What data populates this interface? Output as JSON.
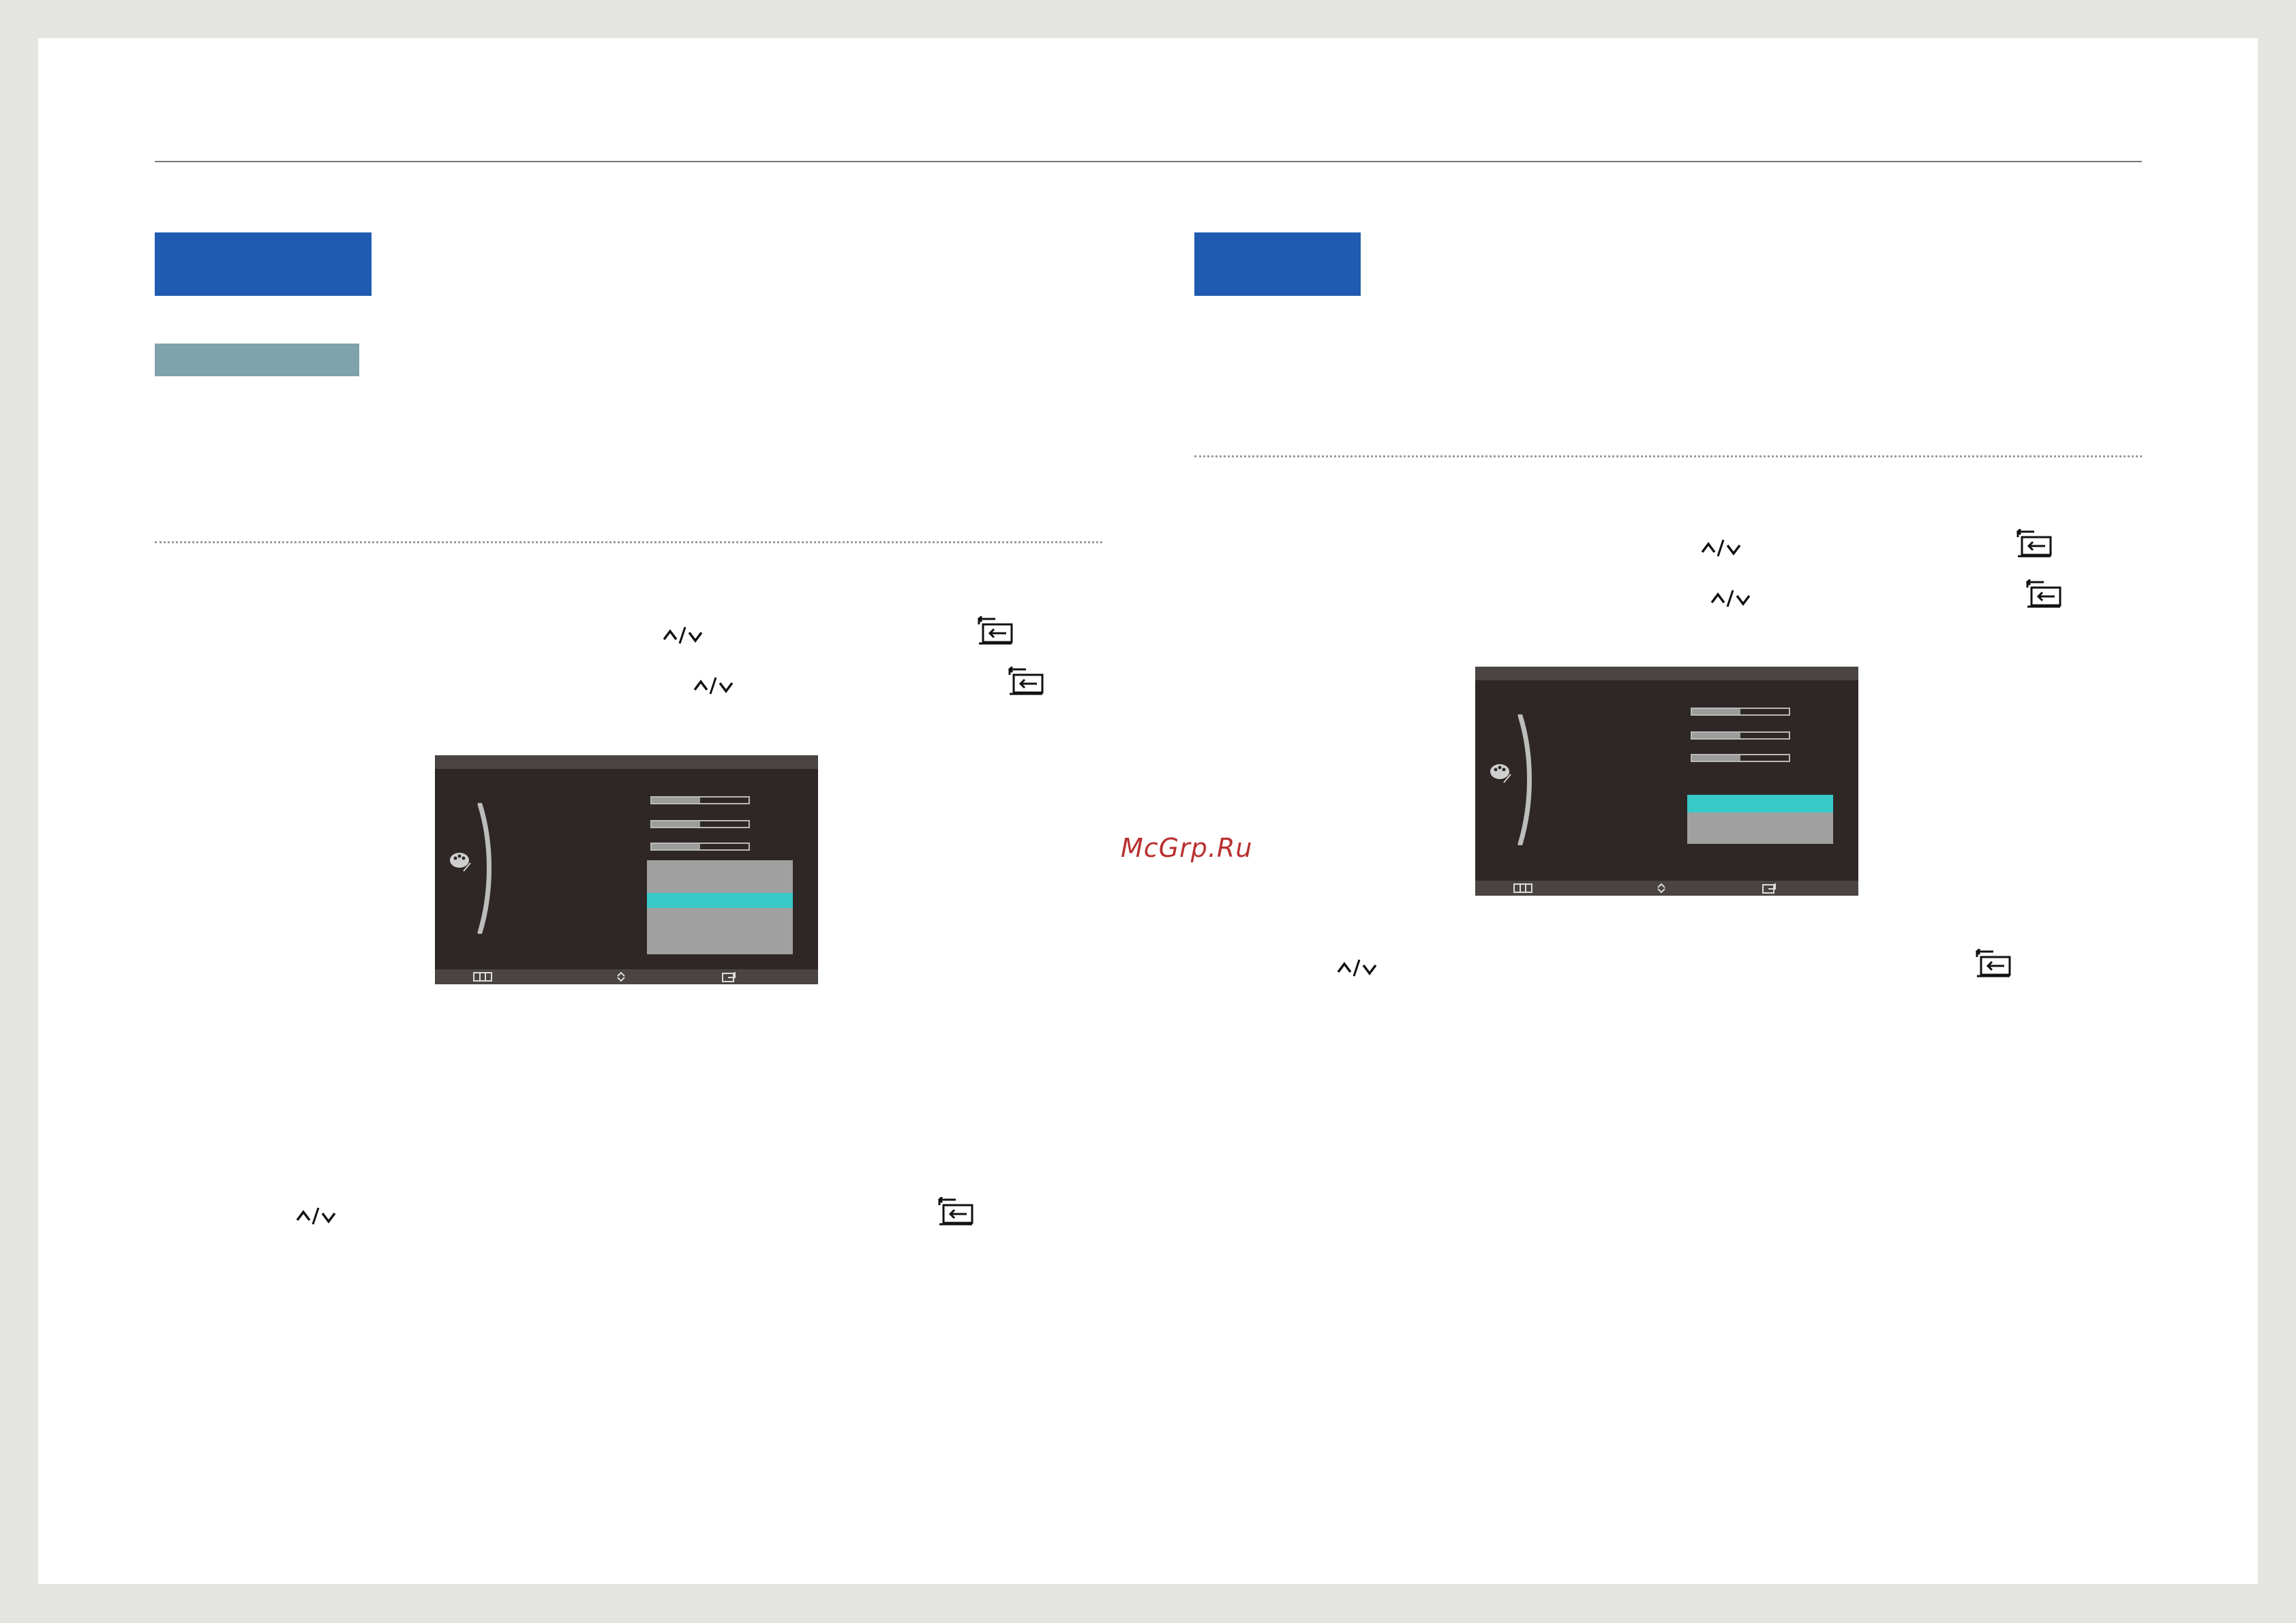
{
  "watermark": "McGrp.Ru",
  "glyphs": {
    "up_down": "^/v",
    "enter_icon": "source-enter-icon"
  },
  "osd_left": {
    "bars": [
      0.5,
      0.5,
      0.5
    ],
    "dropdown_options": 4,
    "selected_index": 2
  },
  "osd_right": {
    "bars": [
      0.5,
      0.5,
      0.5
    ],
    "dropdown_options": 2,
    "selected_index": 0
  },
  "colors": {
    "heading": "#1f5bb0",
    "subheading": "#7fa2ac",
    "osd_bg": "#2e2725",
    "highlight": "#38c9c9"
  }
}
